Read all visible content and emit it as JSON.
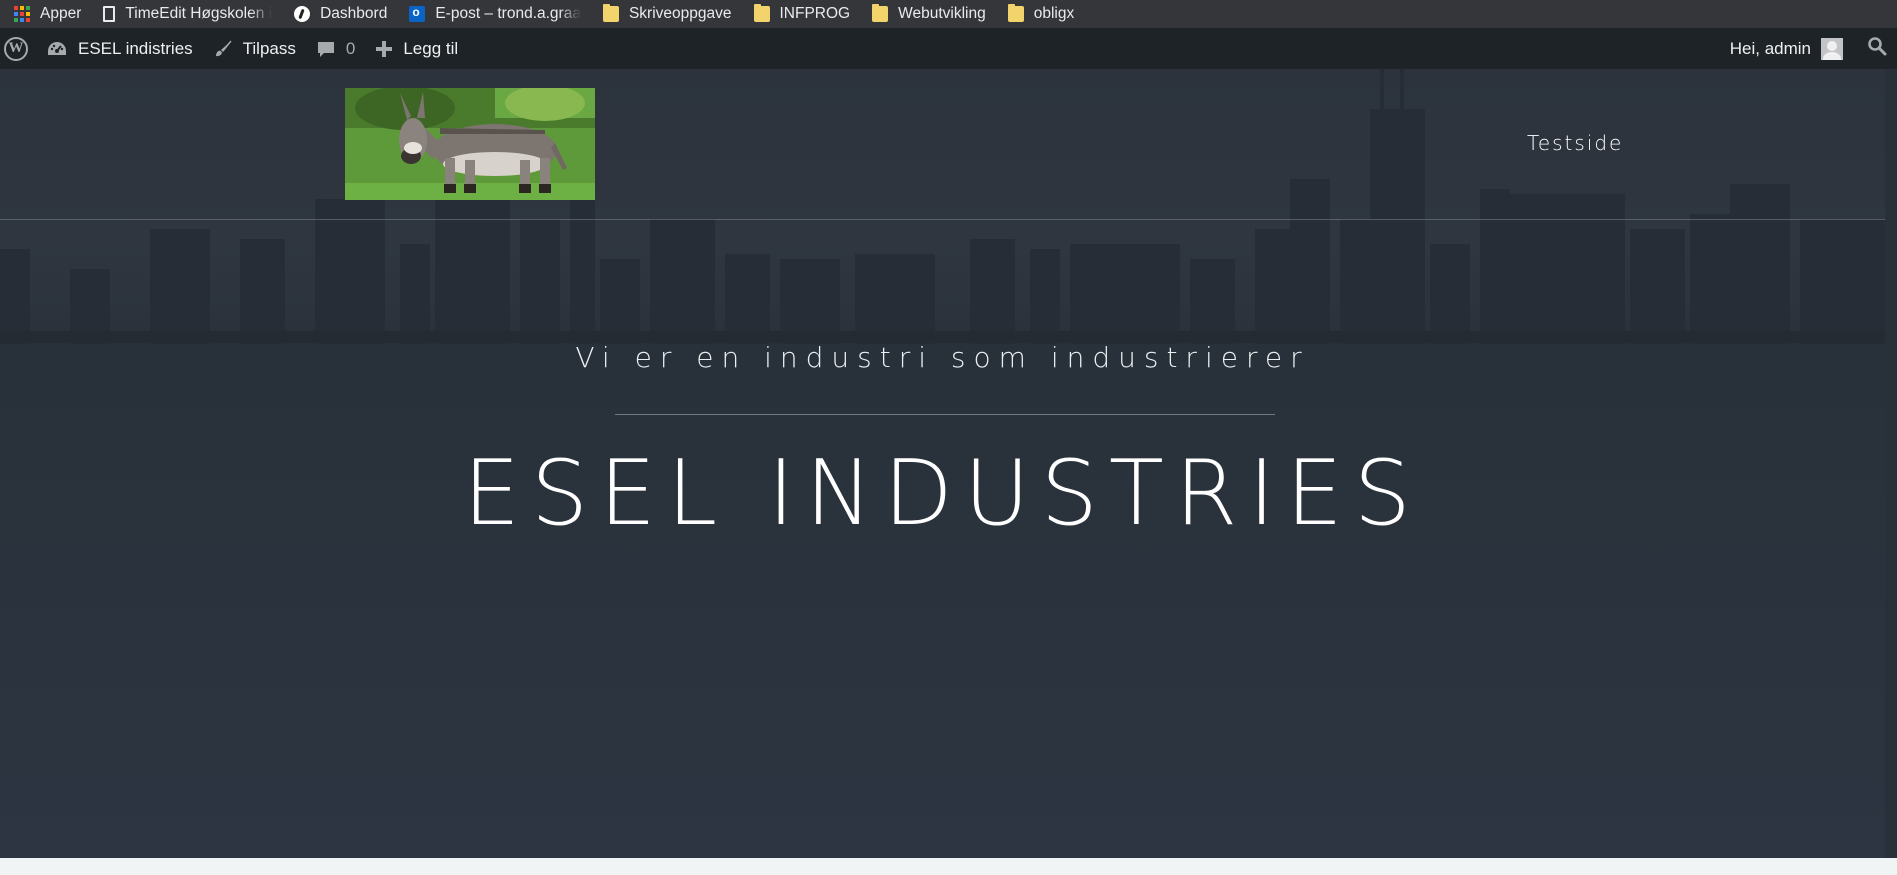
{
  "bookmarks": [
    {
      "label": "Apper",
      "icon": "apps-grid-icon"
    },
    {
      "label": "TimeEdit Høgskolen i",
      "icon": "page-icon"
    },
    {
      "label": "Dashbord",
      "icon": "dashboard-icon"
    },
    {
      "label": "E-post – trond.a.graa",
      "icon": "outlook-icon"
    },
    {
      "label": "Skriveoppgave",
      "icon": "folder-icon"
    },
    {
      "label": "INFPROG",
      "icon": "folder-icon"
    },
    {
      "label": "Webutvikling",
      "icon": "folder-icon"
    },
    {
      "label": "obligx",
      "icon": "folder-icon"
    }
  ],
  "admin_bar": {
    "wp_logo": "W",
    "site_name": "ESEL indistries",
    "customize": "Tilpass",
    "comments_count": "0",
    "new": "Legg til",
    "greeting": "Hei, admin"
  },
  "site": {
    "nav": [
      "Testside"
    ],
    "tagline": "Vi er en industri som industrierer",
    "title": "ESEL INDUSTRIES"
  },
  "colors": {
    "adminbar_bg": "#1d2327",
    "bookmarks_bg": "#35363a",
    "hero_overlay": "#2c333d",
    "text_light": "#ffffff"
  }
}
